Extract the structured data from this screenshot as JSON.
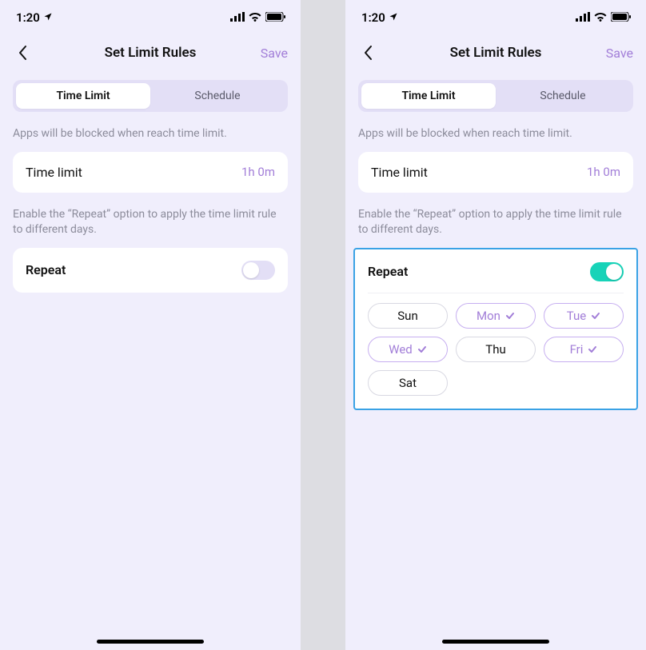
{
  "status": {
    "time": "1:20"
  },
  "nav": {
    "title": "Set Limit Rules",
    "save": "Save"
  },
  "tabs": {
    "time_limit": "Time Limit",
    "schedule": "Schedule"
  },
  "help": {
    "blocked": "Apps will be blocked when reach time limit.",
    "repeat": "Enable the “Repeat” option to apply the time limit rule to different days."
  },
  "time_limit": {
    "label": "Time limit",
    "value": "1h 0m"
  },
  "repeat": {
    "label": "Repeat"
  },
  "days": {
    "sun": "Sun",
    "mon": "Mon",
    "tue": "Tue",
    "wed": "Wed",
    "thu": "Thu",
    "fri": "Fri",
    "sat": "Sat"
  },
  "screens": {
    "left": {
      "repeat_on": false
    },
    "right": {
      "repeat_on": true,
      "selected_days": [
        "mon",
        "tue",
        "wed",
        "fri"
      ],
      "highlighted": true
    }
  },
  "colors": {
    "accent": "#a27ed8",
    "toggle_on": "#17d3b8",
    "highlight_border": "#3aa2e5"
  }
}
